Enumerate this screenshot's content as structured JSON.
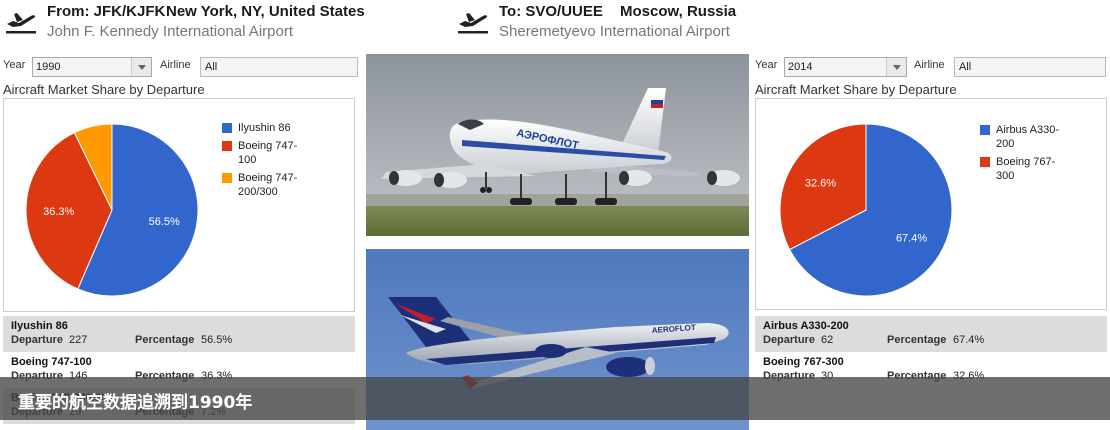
{
  "origin": {
    "code_label": "From: JFK/KJFK",
    "city": "New York, NY, United States",
    "airport": "John F. Kennedy International Airport",
    "icon": "takeoff-plane-icon"
  },
  "destination": {
    "code_label": "To: SVO/UUEE",
    "city": "Moscow, Russia",
    "airport": "Sheremetyevo International Airport",
    "icon": "takeoff-plane-icon"
  },
  "left_panel": {
    "year_label": "Year",
    "year_value": "1990",
    "airline_label": "Airline",
    "airline_value": "All",
    "chart_title": "Aircraft Market Share by Departure",
    "stats": [
      {
        "name": "Ilyushin 86",
        "departure_label": "Departure",
        "departure": "227",
        "percentage_label": "Percentage",
        "percentage": "56.5%"
      },
      {
        "name": "Boeing 747-100",
        "departure_label": "Departure",
        "departure": "146",
        "percentage_label": "Percentage",
        "percentage": "36.3%"
      },
      {
        "name": "Boeing 747-200/300",
        "departure_label": "Departure",
        "departure": "29",
        "percentage_label": "Percentage",
        "percentage": "7.2%"
      }
    ]
  },
  "right_panel": {
    "year_label": "Year",
    "year_value": "2014",
    "airline_label": "Airline",
    "airline_value": "All",
    "chart_title": "Aircraft Market Share by Departure",
    "stats": [
      {
        "name": "Airbus A330-200",
        "departure_label": "Departure",
        "departure": "62",
        "percentage_label": "Percentage",
        "percentage": "67.4%"
      },
      {
        "name": "Boeing 767-300",
        "departure_label": "Departure",
        "departure": "30",
        "percentage_label": "Percentage",
        "percentage": "32.6%"
      }
    ]
  },
  "chart_data": [
    {
      "type": "pie",
      "title": "Aircraft Market Share by Departure",
      "categories": [
        "Ilyushin 86",
        "Boeing 747-100",
        "Boeing 747-200/300"
      ],
      "values": [
        56.5,
        36.3,
        7.2
      ],
      "labels": [
        "56.5%",
        "36.3%",
        ""
      ],
      "colors": [
        "#3366cc",
        "#dc3912",
        "#ff9900"
      ],
      "legend_position": "right"
    },
    {
      "type": "pie",
      "title": "Aircraft Market Share by Departure",
      "categories": [
        "Airbus A330-200",
        "Boeing 767-300"
      ],
      "values": [
        67.4,
        32.6
      ],
      "labels": [
        "67.4%",
        "32.6%"
      ],
      "colors": [
        "#3366cc",
        "#dc3912"
      ],
      "legend_position": "right"
    }
  ],
  "photos": {
    "top_icon": "aeroflot-ilyushin-86-photo",
    "bottom_icon": "aeroflot-airbus-a330-photo",
    "top_livery_text": "АЭРОФЛОТ",
    "bottom_livery_text": "AEROFLOT"
  },
  "caption": "重要的航空数据追溯到1990年"
}
